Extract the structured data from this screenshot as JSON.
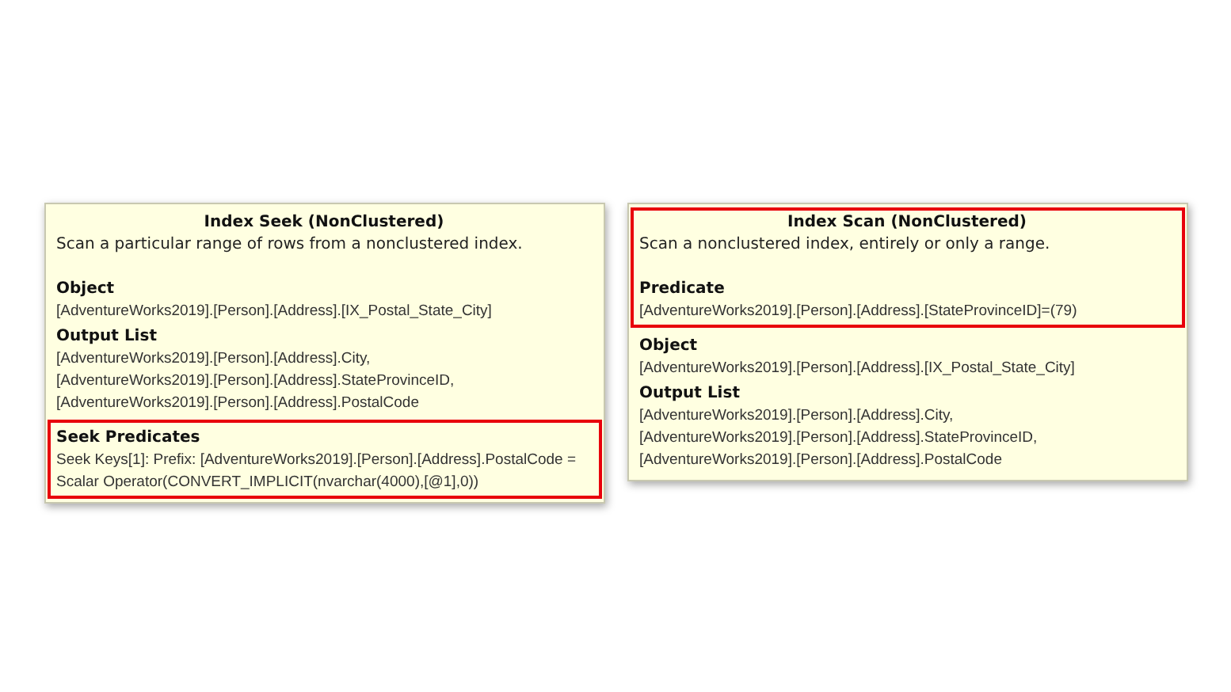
{
  "panels": [
    {
      "blocks": [
        {
          "highlighted": false,
          "title": "Index Seek (NonClustered)",
          "description": "Scan a particular range of rows from a nonclustered index.",
          "sections": [
            {
              "heading": "Object",
              "lines": [
                "[AdventureWorks2019].[Person].[Address].[IX_Postal_State_City]"
              ]
            },
            {
              "heading": "Output List",
              "lines": [
                "[AdventureWorks2019].[Person].[Address].City,",
                "[AdventureWorks2019].[Person].[Address].StateProvinceID,",
                "[AdventureWorks2019].[Person].[Address].PostalCode"
              ]
            }
          ]
        },
        {
          "highlighted": true,
          "sections": [
            {
              "heading": "Seek Predicates",
              "lines": [
                "Seek Keys[1]: Prefix: [AdventureWorks2019].[Person].[Address].PostalCode = Scalar Operator(CONVERT_IMPLICIT(nvarchar(4000),[@1],0))"
              ]
            }
          ]
        }
      ]
    },
    {
      "blocks": [
        {
          "highlighted": true,
          "title": "Index Scan (NonClustered)",
          "description": "Scan a nonclustered index, entirely or only a range.",
          "sections": [
            {
              "heading": "Predicate",
              "lines": [
                "[AdventureWorks2019].[Person].[Address].[StateProvinceID]=(79)"
              ]
            }
          ]
        },
        {
          "highlighted": false,
          "sections": [
            {
              "heading": "Object",
              "lines": [
                "[AdventureWorks2019].[Person].[Address].[IX_Postal_State_City]"
              ]
            },
            {
              "heading": "Output List",
              "lines": [
                "[AdventureWorks2019].[Person].[Address].City,",
                "[AdventureWorks2019].[Person].[Address].StateProvinceID,",
                "[AdventureWorks2019].[Person].[Address].PostalCode"
              ]
            }
          ]
        }
      ]
    }
  ]
}
